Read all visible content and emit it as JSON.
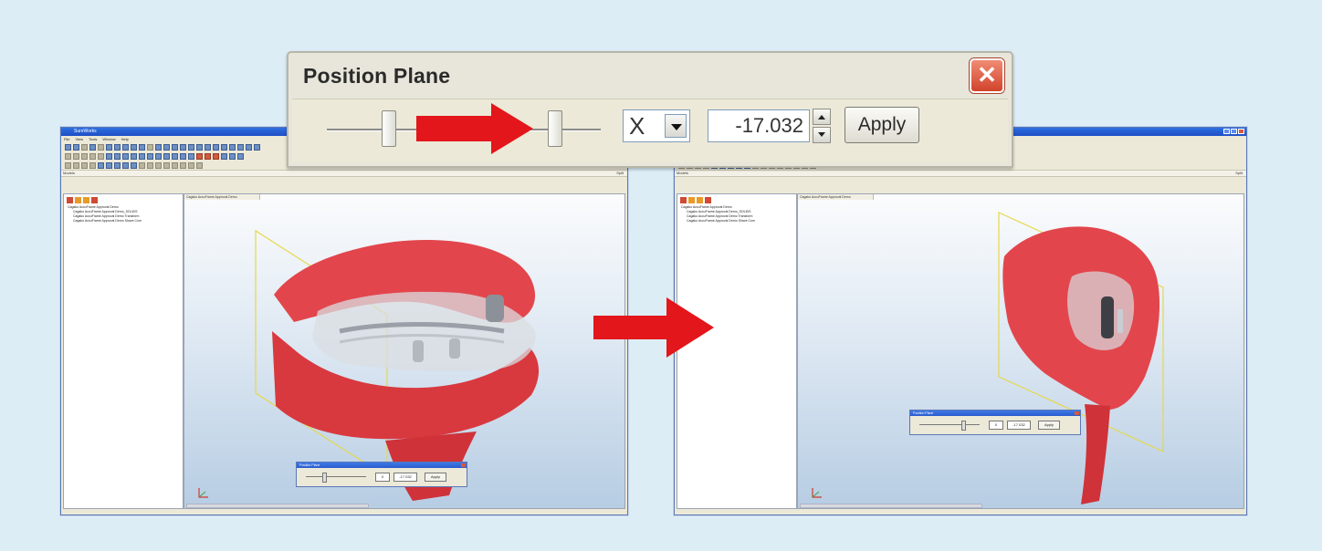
{
  "dialog": {
    "title": "Position Plane",
    "axis_value": "X",
    "offset_value": "-17.032",
    "apply_label": "Apply"
  },
  "left_app": {
    "title": "SureWorks",
    "menu": [
      "File",
      "View",
      "Tools",
      "Window",
      "Help"
    ],
    "panel_left": "Models",
    "panel_right": "Split",
    "viewport_tab": "Cagako AccuFrame Approval Demo",
    "tree": [
      "Cagako AccuFrame Approval Demo",
      "Cagako AccuFrame Approval Demo_SOLIDS",
      "Cagako AccuFrame Approval Demo Transform",
      "Cagako AccuFrame Approval Demo Shave Com"
    ],
    "mini_dialog": {
      "title": "Position Plane",
      "axis_value": "X",
      "offset_value": "-17.032",
      "apply_label": "Apply"
    }
  },
  "right_app": {
    "panel_left": "Models",
    "panel_right": "Split",
    "viewport_tab": "Cagako AccuFrame Approval Demo",
    "tree": [
      "Cagako AccuFrame Approval Demo",
      "Cagako AccuFrame Approval Demo_SOLIDS",
      "Cagako AccuFrame Approval Demo Transform",
      "Cagako AccuFrame Approval Demo Shave Com"
    ],
    "mini_dialog": {
      "title": "Position Plane",
      "axis_value": "X",
      "offset_value": "-17.032",
      "apply_label": "Apply"
    }
  },
  "colors": {
    "background": "#dcedf6",
    "arrow": "#e3161b",
    "model": "#e2464c",
    "plane": "#e6d84a"
  },
  "icons": [
    "close-icon",
    "dropdown-arrow-icon",
    "spin-up-icon",
    "spin-down-icon",
    "right-arrow-icon",
    "axis-gizmo-icon"
  ]
}
